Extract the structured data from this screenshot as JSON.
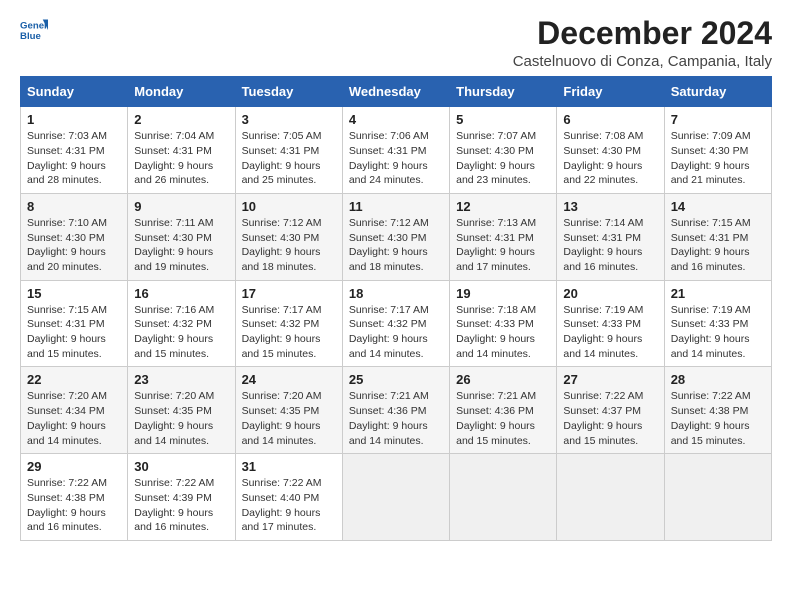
{
  "logo": {
    "line1": "General",
    "line2": "Blue"
  },
  "title": "December 2024",
  "location": "Castelnuovo di Conza, Campania, Italy",
  "days_of_week": [
    "Sunday",
    "Monday",
    "Tuesday",
    "Wednesday",
    "Thursday",
    "Friday",
    "Saturday"
  ],
  "weeks": [
    [
      {
        "day": "1",
        "sunrise": "Sunrise: 7:03 AM",
        "sunset": "Sunset: 4:31 PM",
        "daylight": "Daylight: 9 hours and 28 minutes."
      },
      {
        "day": "2",
        "sunrise": "Sunrise: 7:04 AM",
        "sunset": "Sunset: 4:31 PM",
        "daylight": "Daylight: 9 hours and 26 minutes."
      },
      {
        "day": "3",
        "sunrise": "Sunrise: 7:05 AM",
        "sunset": "Sunset: 4:31 PM",
        "daylight": "Daylight: 9 hours and 25 minutes."
      },
      {
        "day": "4",
        "sunrise": "Sunrise: 7:06 AM",
        "sunset": "Sunset: 4:31 PM",
        "daylight": "Daylight: 9 hours and 24 minutes."
      },
      {
        "day": "5",
        "sunrise": "Sunrise: 7:07 AM",
        "sunset": "Sunset: 4:30 PM",
        "daylight": "Daylight: 9 hours and 23 minutes."
      },
      {
        "day": "6",
        "sunrise": "Sunrise: 7:08 AM",
        "sunset": "Sunset: 4:30 PM",
        "daylight": "Daylight: 9 hours and 22 minutes."
      },
      {
        "day": "7",
        "sunrise": "Sunrise: 7:09 AM",
        "sunset": "Sunset: 4:30 PM",
        "daylight": "Daylight: 9 hours and 21 minutes."
      }
    ],
    [
      {
        "day": "8",
        "sunrise": "Sunrise: 7:10 AM",
        "sunset": "Sunset: 4:30 PM",
        "daylight": "Daylight: 9 hours and 20 minutes."
      },
      {
        "day": "9",
        "sunrise": "Sunrise: 7:11 AM",
        "sunset": "Sunset: 4:30 PM",
        "daylight": "Daylight: 9 hours and 19 minutes."
      },
      {
        "day": "10",
        "sunrise": "Sunrise: 7:12 AM",
        "sunset": "Sunset: 4:30 PM",
        "daylight": "Daylight: 9 hours and 18 minutes."
      },
      {
        "day": "11",
        "sunrise": "Sunrise: 7:12 AM",
        "sunset": "Sunset: 4:30 PM",
        "daylight": "Daylight: 9 hours and 18 minutes."
      },
      {
        "day": "12",
        "sunrise": "Sunrise: 7:13 AM",
        "sunset": "Sunset: 4:31 PM",
        "daylight": "Daylight: 9 hours and 17 minutes."
      },
      {
        "day": "13",
        "sunrise": "Sunrise: 7:14 AM",
        "sunset": "Sunset: 4:31 PM",
        "daylight": "Daylight: 9 hours and 16 minutes."
      },
      {
        "day": "14",
        "sunrise": "Sunrise: 7:15 AM",
        "sunset": "Sunset: 4:31 PM",
        "daylight": "Daylight: 9 hours and 16 minutes."
      }
    ],
    [
      {
        "day": "15",
        "sunrise": "Sunrise: 7:15 AM",
        "sunset": "Sunset: 4:31 PM",
        "daylight": "Daylight: 9 hours and 15 minutes."
      },
      {
        "day": "16",
        "sunrise": "Sunrise: 7:16 AM",
        "sunset": "Sunset: 4:32 PM",
        "daylight": "Daylight: 9 hours and 15 minutes."
      },
      {
        "day": "17",
        "sunrise": "Sunrise: 7:17 AM",
        "sunset": "Sunset: 4:32 PM",
        "daylight": "Daylight: 9 hours and 15 minutes."
      },
      {
        "day": "18",
        "sunrise": "Sunrise: 7:17 AM",
        "sunset": "Sunset: 4:32 PM",
        "daylight": "Daylight: 9 hours and 14 minutes."
      },
      {
        "day": "19",
        "sunrise": "Sunrise: 7:18 AM",
        "sunset": "Sunset: 4:33 PM",
        "daylight": "Daylight: 9 hours and 14 minutes."
      },
      {
        "day": "20",
        "sunrise": "Sunrise: 7:19 AM",
        "sunset": "Sunset: 4:33 PM",
        "daylight": "Daylight: 9 hours and 14 minutes."
      },
      {
        "day": "21",
        "sunrise": "Sunrise: 7:19 AM",
        "sunset": "Sunset: 4:33 PM",
        "daylight": "Daylight: 9 hours and 14 minutes."
      }
    ],
    [
      {
        "day": "22",
        "sunrise": "Sunrise: 7:20 AM",
        "sunset": "Sunset: 4:34 PM",
        "daylight": "Daylight: 9 hours and 14 minutes."
      },
      {
        "day": "23",
        "sunrise": "Sunrise: 7:20 AM",
        "sunset": "Sunset: 4:35 PM",
        "daylight": "Daylight: 9 hours and 14 minutes."
      },
      {
        "day": "24",
        "sunrise": "Sunrise: 7:20 AM",
        "sunset": "Sunset: 4:35 PM",
        "daylight": "Daylight: 9 hours and 14 minutes."
      },
      {
        "day": "25",
        "sunrise": "Sunrise: 7:21 AM",
        "sunset": "Sunset: 4:36 PM",
        "daylight": "Daylight: 9 hours and 14 minutes."
      },
      {
        "day": "26",
        "sunrise": "Sunrise: 7:21 AM",
        "sunset": "Sunset: 4:36 PM",
        "daylight": "Daylight: 9 hours and 15 minutes."
      },
      {
        "day": "27",
        "sunrise": "Sunrise: 7:22 AM",
        "sunset": "Sunset: 4:37 PM",
        "daylight": "Daylight: 9 hours and 15 minutes."
      },
      {
        "day": "28",
        "sunrise": "Sunrise: 7:22 AM",
        "sunset": "Sunset: 4:38 PM",
        "daylight": "Daylight: 9 hours and 15 minutes."
      }
    ],
    [
      {
        "day": "29",
        "sunrise": "Sunrise: 7:22 AM",
        "sunset": "Sunset: 4:38 PM",
        "daylight": "Daylight: 9 hours and 16 minutes."
      },
      {
        "day": "30",
        "sunrise": "Sunrise: 7:22 AM",
        "sunset": "Sunset: 4:39 PM",
        "daylight": "Daylight: 9 hours and 16 minutes."
      },
      {
        "day": "31",
        "sunrise": "Sunrise: 7:22 AM",
        "sunset": "Sunset: 4:40 PM",
        "daylight": "Daylight: 9 hours and 17 minutes."
      },
      null,
      null,
      null,
      null
    ]
  ]
}
